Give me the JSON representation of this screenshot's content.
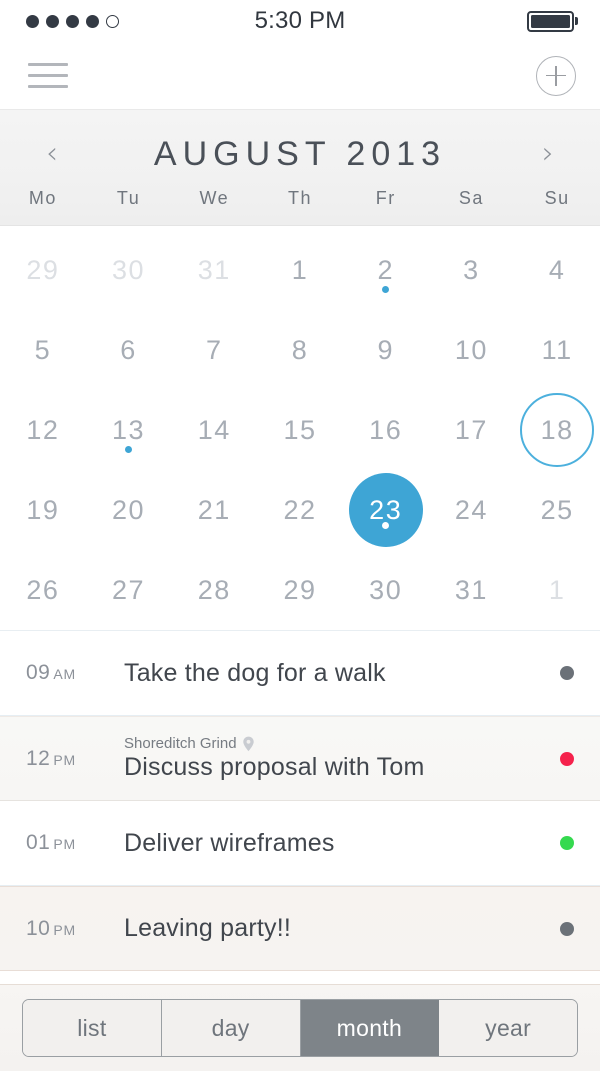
{
  "status_bar": {
    "signal_dots_total": 5,
    "signal_dots_filled": 4,
    "time": "5:30 PM",
    "battery_full": true
  },
  "nav_bar": {
    "menu_icon": "hamburger-icon",
    "add_icon": "plus-circle-icon"
  },
  "calendar": {
    "title": "AUGUST 2013",
    "prev_label": "‹",
    "next_label": "›",
    "weekdays": [
      "Mo",
      "Tu",
      "We",
      "Th",
      "Fr",
      "Sa",
      "Su"
    ],
    "accent_color": "#3ea5d5",
    "days": [
      {
        "n": "29",
        "state": "muted"
      },
      {
        "n": "30",
        "state": "muted"
      },
      {
        "n": "31",
        "state": "muted"
      },
      {
        "n": "1",
        "state": "normal"
      },
      {
        "n": "2",
        "state": "normal",
        "dot": true
      },
      {
        "n": "3",
        "state": "normal"
      },
      {
        "n": "4",
        "state": "normal"
      },
      {
        "n": "5",
        "state": "normal"
      },
      {
        "n": "6",
        "state": "normal"
      },
      {
        "n": "7",
        "state": "normal"
      },
      {
        "n": "8",
        "state": "normal"
      },
      {
        "n": "9",
        "state": "normal"
      },
      {
        "n": "10",
        "state": "normal"
      },
      {
        "n": "11",
        "state": "normal"
      },
      {
        "n": "12",
        "state": "normal"
      },
      {
        "n": "13",
        "state": "normal",
        "dot": true
      },
      {
        "n": "14",
        "state": "normal"
      },
      {
        "n": "15",
        "state": "normal"
      },
      {
        "n": "16",
        "state": "normal"
      },
      {
        "n": "17",
        "state": "normal"
      },
      {
        "n": "18",
        "state": "today"
      },
      {
        "n": "19",
        "state": "normal"
      },
      {
        "n": "20",
        "state": "normal"
      },
      {
        "n": "21",
        "state": "normal"
      },
      {
        "n": "22",
        "state": "normal"
      },
      {
        "n": "23",
        "state": "selected",
        "dot": true
      },
      {
        "n": "24",
        "state": "normal"
      },
      {
        "n": "25",
        "state": "normal"
      },
      {
        "n": "26",
        "state": "normal"
      },
      {
        "n": "27",
        "state": "normal"
      },
      {
        "n": "28",
        "state": "normal"
      },
      {
        "n": "29",
        "state": "normal"
      },
      {
        "n": "30",
        "state": "normal"
      },
      {
        "n": "31",
        "state": "normal"
      },
      {
        "n": "1",
        "state": "muted"
      }
    ]
  },
  "events": [
    {
      "time": "09",
      "ampm": "AM",
      "title": "Take the dog for a walk",
      "location": "",
      "dot_color": "#6b7178",
      "row_style": "alt-a"
    },
    {
      "time": "12",
      "ampm": "PM",
      "title": "Discuss proposal with Tom",
      "location": "Shoreditch Grind",
      "dot_color": "#f5224c",
      "row_style": "alt-b"
    },
    {
      "time": "01",
      "ampm": "PM",
      "title": "Deliver wireframes",
      "location": "",
      "dot_color": "#35d94f",
      "row_style": "alt-a"
    },
    {
      "time": "10",
      "ampm": "PM",
      "title": "Leaving party!!",
      "location": "",
      "dot_color": "#6b7178",
      "row_style": "alt-c"
    }
  ],
  "view_switcher": {
    "options": [
      "list",
      "day",
      "month",
      "year"
    ],
    "selected": "month"
  }
}
